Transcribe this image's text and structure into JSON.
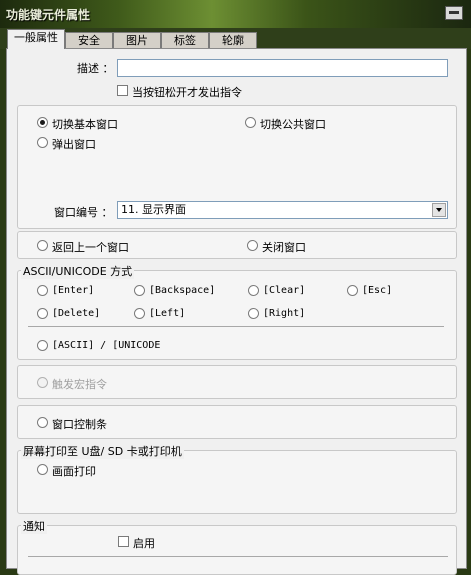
{
  "window": {
    "title": "功能键元件属性"
  },
  "tabs": [
    "一般属性",
    "安全",
    "图片",
    "标签",
    "轮廓"
  ],
  "general": {
    "description_label": "描述 ：",
    "description_value": "",
    "release_checkbox": "当按钮松开才发出指令"
  },
  "window_switch": {
    "switch_basic": "切换基本窗口",
    "switch_common": "切换公共窗口",
    "popup": "弹出窗口",
    "window_no_label": "窗口编号 ：",
    "window_no_value": "11. 显示界面"
  },
  "nav": {
    "back": "返回上一个窗口",
    "close": "关闭窗口"
  },
  "ascii": {
    "group_label": "ASCII/UNICODE 方式",
    "enter": "[Enter]",
    "backspace": "[Backspace]",
    "clear": "[Clear]",
    "esc": "[Esc]",
    "delete": "[Delete]",
    "left": "[Left]",
    "right": "[Right]",
    "ascii_unicode": "[ASCII] / [UNICODE"
  },
  "macro": {
    "trigger": "触发宏指令"
  },
  "control": {
    "window_bar": "窗口控制条"
  },
  "print": {
    "group_label": "屏幕打印至 U盘/ SD 卡或打印机",
    "print_screen": "画面打印"
  },
  "notify": {
    "group_label": "通知",
    "enable": "启用"
  }
}
